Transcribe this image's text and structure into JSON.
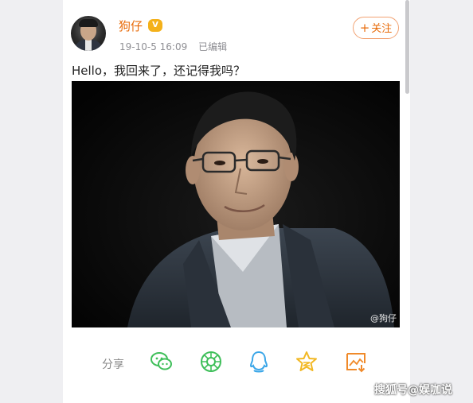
{
  "post": {
    "author_name": "狗仔",
    "vip_badge": "V",
    "date": "19-10-5 16:09",
    "edited_label": "已编辑",
    "follow_label": "关注",
    "follow_plus": "+",
    "text": "Hello，我回来了，还记得我吗？",
    "photo_watermark": "@狗仔"
  },
  "share": {
    "label": "分享",
    "icons": [
      "wechat-icon",
      "moments-icon",
      "qq-icon",
      "qzone-icon",
      "save-image-icon"
    ]
  },
  "page_watermark": "搜狐号@娱咖说",
  "colors": {
    "accent_orange": "#e86b0a",
    "wechat_green": "#3fbf5a",
    "qq_blue": "#3aa6e8",
    "qzone_yellow": "#f2b824",
    "save_orange": "#f08a2a"
  }
}
